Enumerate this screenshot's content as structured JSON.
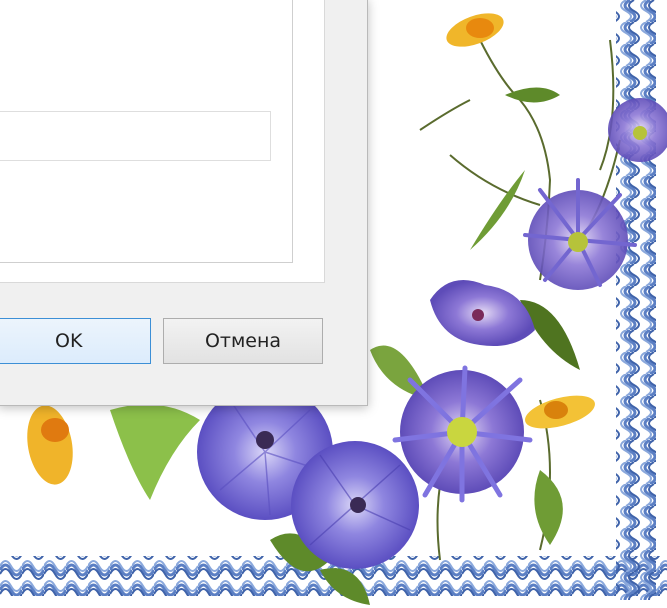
{
  "dialog": {
    "text_field_value": "",
    "ok_label": "OK",
    "cancel_label": "Отмена"
  },
  "wallpaper": {
    "border_color": "#5b7fc4",
    "flowers": [
      "blue-geranium-flower",
      "purple-aster-flower",
      "yellow-daisy-flower",
      "green-leaf"
    ]
  }
}
